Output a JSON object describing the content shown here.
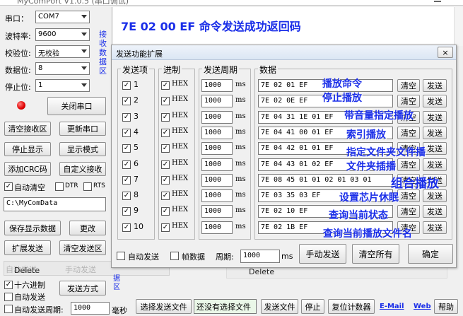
{
  "window": {
    "title": "MyComPort V1.0.5 (串口调试)"
  },
  "banner": {
    "text": "7E 02 00 EF  命令发送成功返回码"
  },
  "left": {
    "port_label": "串口：",
    "port_value": "COM7",
    "baud_label": "波特率:",
    "baud_value": "9600",
    "parity_label": "校验位:",
    "parity_value": "无校验",
    "data_label": "数据位:",
    "data_value": "8",
    "stop_label": "停止位:",
    "stop_value": "1",
    "close_port": "关闭串口",
    "clear_recv": "清空接收区",
    "refresh_port": "更新串口",
    "stop_display": "停止显示",
    "display_mode": "显示模式",
    "add_crc": "添加CRC码",
    "custom_recv": "自定义接收",
    "auto_clear": "自动清空",
    "dtr": "DTR",
    "rts": "RTS",
    "path": "C:\\MyComData",
    "save_display": "保存显示数据",
    "change": "更改",
    "ext_send": "扩展发送",
    "clear_send": "清空发送区",
    "hex_send": "十六进制",
    "auto_send": "自动发送",
    "send_mode": "发送方式",
    "auto_period_label": "自动发送周期:",
    "auto_period_value": "1000",
    "ms_label": "毫秒",
    "recv_area_label": "接收数据区"
  },
  "bottom_bar": {
    "choose_file": "选择发送文件",
    "no_file": "还没有选择文件",
    "send_file": "发送文件",
    "stop": "停止",
    "reset_counter": "复位计数器",
    "email": "E-Mail",
    "web": "Web",
    "help": "帮助",
    "recv_area_short": "据区"
  },
  "dialog": {
    "title": "发送功能扩展",
    "close": "×",
    "headers": {
      "item": "发送项",
      "base": "进制",
      "period": "发送周期",
      "data": "数据"
    },
    "ms": "ms",
    "hex": "HEX",
    "clear": "清空",
    "send": "发送",
    "rows": [
      {
        "n": "1",
        "period": "1000",
        "data": "7E 02 01 EF",
        "note": "播放命令"
      },
      {
        "n": "2",
        "period": "1000",
        "data": "7E 02 0E EF",
        "note": "停止播放"
      },
      {
        "n": "3",
        "period": "1000",
        "data": "7E 04 31 1E 01 EF",
        "note": "带音量指定播放"
      },
      {
        "n": "4",
        "period": "1000",
        "data": "7E 04 41 00 01 EF",
        "note": "索引播放"
      },
      {
        "n": "5",
        "period": "1000",
        "data": "7E 04 42 01 01 EF",
        "note": "指定文件夹文件播"
      },
      {
        "n": "6",
        "period": "1000",
        "data": "7E 04 43 01 02 EF",
        "note": "文件夹插播"
      },
      {
        "n": "7",
        "period": "1000",
        "data": "7E 08 45 01 01 02 01 03 01",
        "note": "组合播放"
      },
      {
        "n": "8",
        "period": "1000",
        "data": "7E 03 35 03 EF",
        "note": "设置芯片休眠"
      },
      {
        "n": "9",
        "period": "1000",
        "data": "7E 02 10 EF",
        "note": "查询当前状态"
      },
      {
        "n": "10",
        "period": "1000",
        "data": "7E 02 1B EF",
        "note": "查询当前播放文件名"
      }
    ],
    "auto_send": "自动发送",
    "frame_data": "帧数据",
    "period_label": "周期:",
    "period_value": "1000",
    "period_ms": "ms",
    "manual_send": "手动发送",
    "clear_all": "清空所有",
    "confirm": "确定"
  },
  "ghost": {
    "delete1": "Delete",
    "delete2": "Delete",
    "auto_send_ghost": "自动发送",
    "manual_send_ghost": "手动发送"
  }
}
